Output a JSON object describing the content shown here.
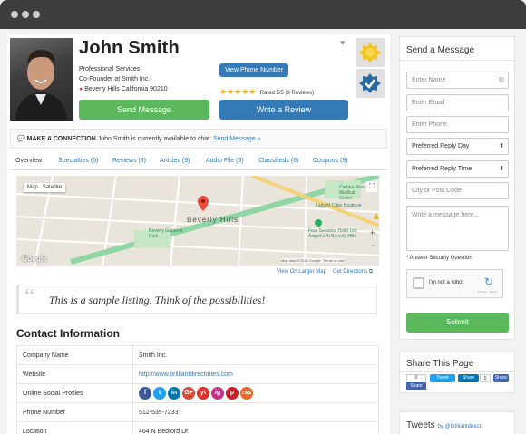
{
  "profile": {
    "name": "John Smith",
    "category": "Professional Services",
    "title": "Co-Founder at Smith Inc.",
    "location": "Beverly Hills California 90210",
    "view_phone_label": "View Phone Number",
    "rating_text": "Rated 5/5 (3 Reviews)",
    "send_message_label": "Send Message",
    "write_review_label": "Write a Review"
  },
  "connection": {
    "heading": "MAKE A CONNECTION",
    "text": "John Smith is currently available to chat:",
    "link": "Send Message »"
  },
  "tabs": [
    {
      "label": "Overview"
    },
    {
      "label": "Specialties (5)"
    },
    {
      "label": "Reviews (3)"
    },
    {
      "label": "Articles (9)"
    },
    {
      "label": "Audio File (9)"
    },
    {
      "label": "Classifieds (8)"
    },
    {
      "label": "Coupons (9)"
    }
  ],
  "map": {
    "map_label": "Map",
    "satellite_label": "Satellite",
    "city_label": "Beverly Hills",
    "park_label": "Beverly Gardens Park",
    "hotel_label": "Four Seasons Hotel Los Angeles At Beverly Hills",
    "cedars_label": "Cedars-Sinai Medical Center",
    "lacma_label": "Lady M Cake Boutique",
    "google_label": "Google",
    "attribution": "Map data ©2018 Google",
    "terms": "Terms of Use",
    "view_larger": "View On Larger Map",
    "directions": "Get Directions"
  },
  "quote": "This is a sample listing. Think of the possibilities!",
  "contact": {
    "title": "Contact Information",
    "rows": [
      {
        "key": "Company Name",
        "value": "Smith Inc."
      },
      {
        "key": "Website",
        "value": "http://www.brilliantdirectories.com"
      },
      {
        "key": "Online Social Profiles",
        "value": ""
      },
      {
        "key": "Phone Number",
        "value": "512-535-7233"
      },
      {
        "key": "Location",
        "value": "464 N Bedford Dr"
      }
    ],
    "social": [
      "f",
      "t",
      "in",
      "G+",
      "yt",
      "ig",
      "p",
      "rss"
    ]
  },
  "sidebar": {
    "send_title": "Send a Message",
    "name_placeholder": "Enter Name",
    "email_placeholder": "Enter Email",
    "phone_placeholder": "Enter Phone",
    "reply_day": "Preferred Reply Day",
    "reply_time": "Preferred Reply Time",
    "city_placeholder": "City or Post Code",
    "message_placeholder": "Write a message here...",
    "security_question": "* Answer Security Question",
    "not_robot": "I'm not a robot",
    "recaptcha_terms": "Privacy - Terms",
    "submit_label": "Submit",
    "share_title": "Share This Page",
    "like_count": "0",
    "share_label": "Share",
    "tweet_label": "Tweet",
    "in_share_label": "Share",
    "in_count": "0",
    "fb_share_label": "Share",
    "tweets_title": "Tweets",
    "tweets_by": "by @brilliantdirect"
  },
  "colors": {
    "green": "#5cb85c",
    "blue": "#337ab7",
    "titlebar": "#3d3d3d"
  }
}
